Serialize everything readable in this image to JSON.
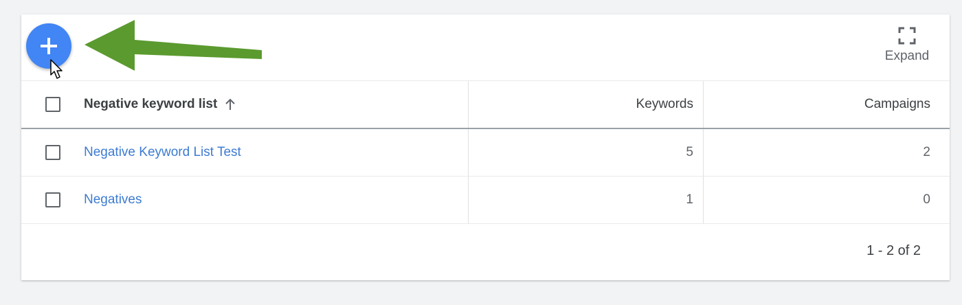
{
  "toolbar": {
    "add_button_icon": "plus-icon",
    "expand_icon": "fullscreen-icon",
    "expand_label": "Expand",
    "accent_color": "#4285f4",
    "annotation_arrow_color": "#5b9a2f"
  },
  "table": {
    "columns": {
      "name": "Negative keyword list",
      "keywords": "Keywords",
      "campaigns": "Campaigns"
    },
    "sort_icon": "arrow-up-icon",
    "rows": [
      {
        "name": "Negative Keyword List Test",
        "keywords": "5",
        "campaigns": "2"
      },
      {
        "name": "Negatives",
        "keywords": "1",
        "campaigns": "0"
      }
    ]
  },
  "pagination": {
    "text": "1 - 2 of 2"
  }
}
